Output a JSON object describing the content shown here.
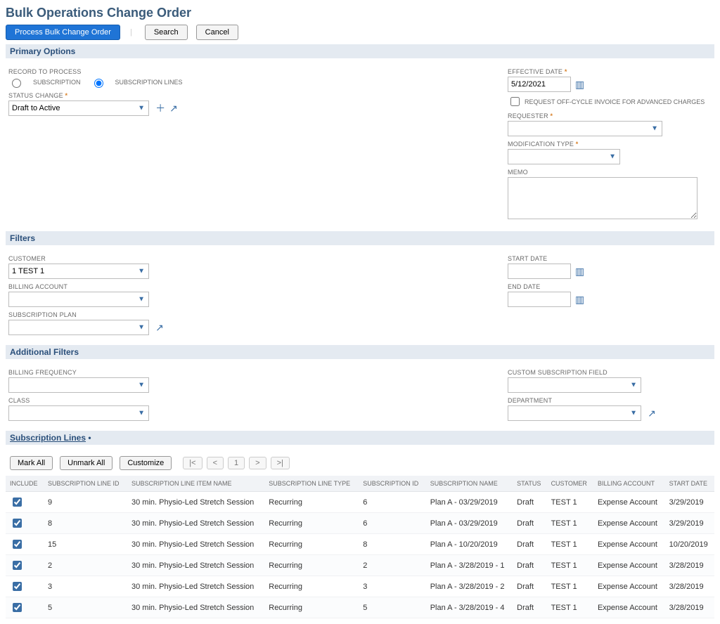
{
  "page": {
    "title": "Bulk Operations Change Order"
  },
  "toolbar": {
    "process": "Process Bulk Change Order",
    "search": "Search",
    "cancel": "Cancel"
  },
  "sections": {
    "primary": "Primary Options",
    "filters": "Filters",
    "additional": "Additional Filters",
    "sublines": "Subscription Lines"
  },
  "primary": {
    "record_to_process_label": "RECORD TO PROCESS",
    "radio_subscription": "SUBSCRIPTION",
    "radio_subscription_lines": "SUBSCRIPTION LINES",
    "status_change_label": "STATUS CHANGE",
    "status_change_value": "Draft to Active",
    "effective_date_label": "EFFECTIVE DATE",
    "effective_date_value": "5/12/2021",
    "offcycle_label": "REQUEST OFF-CYCLE INVOICE FOR ADVANCED CHARGES",
    "requester_label": "REQUESTER",
    "requester_value": "",
    "modification_type_label": "MODIFICATION TYPE",
    "modification_type_value": "",
    "memo_label": "MEMO",
    "memo_value": ""
  },
  "filters": {
    "customer_label": "CUSTOMER",
    "customer_value": "1 TEST 1",
    "billing_account_label": "BILLING ACCOUNT",
    "billing_account_value": "",
    "subscription_plan_label": "SUBSCRIPTION PLAN",
    "subscription_plan_value": "",
    "start_date_label": "START DATE",
    "start_date_value": "",
    "end_date_label": "END DATE",
    "end_date_value": ""
  },
  "additional": {
    "billing_frequency_label": "BILLING FREQUENCY",
    "billing_frequency_value": "",
    "class_label": "CLASS",
    "class_value": "",
    "custom_sub_field_label": "CUSTOM SUBSCRIPTION FIELD",
    "custom_sub_field_value": "",
    "department_label": "DEPARTMENT",
    "department_value": ""
  },
  "sublines": {
    "mark_all": "Mark All",
    "unmark_all": "Unmark All",
    "customize": "Customize",
    "pager": {
      "first": "|<",
      "prev": "<",
      "page": "1",
      "next": ">",
      "last": ">|"
    },
    "headers": {
      "include": "INCLUDE",
      "line_id": "SUBSCRIPTION LINE ID",
      "item_name": "SUBSCRIPTION LINE ITEM NAME",
      "line_type": "SUBSCRIPTION LINE TYPE",
      "sub_id": "SUBSCRIPTION ID",
      "sub_name": "SUBSCRIPTION NAME",
      "status": "STATUS",
      "customer": "CUSTOMER",
      "billing_account": "BILLING ACCOUNT",
      "start_date": "START DATE"
    },
    "rows": [
      {
        "include": true,
        "line_id": "9",
        "item_name": "30 min. Physio-Led Stretch Session",
        "line_type": "Recurring",
        "sub_id": "6",
        "sub_name": "Plan A - 03/29/2019",
        "status": "Draft",
        "customer": "TEST 1",
        "billing_account": "Expense Account",
        "start_date": "3/29/2019"
      },
      {
        "include": true,
        "line_id": "8",
        "item_name": "30 min. Physio-Led Stretch Session",
        "line_type": "Recurring",
        "sub_id": "6",
        "sub_name": "Plan A - 03/29/2019",
        "status": "Draft",
        "customer": "TEST 1",
        "billing_account": "Expense Account",
        "start_date": "3/29/2019"
      },
      {
        "include": true,
        "line_id": "15",
        "item_name": "30 min. Physio-Led Stretch Session",
        "line_type": "Recurring",
        "sub_id": "8",
        "sub_name": "Plan A - 10/20/2019",
        "status": "Draft",
        "customer": "TEST 1",
        "billing_account": "Expense Account",
        "start_date": "10/20/2019"
      },
      {
        "include": true,
        "line_id": "2",
        "item_name": "30 min. Physio-Led Stretch Session",
        "line_type": "Recurring",
        "sub_id": "2",
        "sub_name": "Plan A - 3/28/2019 - 1",
        "status": "Draft",
        "customer": "TEST 1",
        "billing_account": "Expense Account",
        "start_date": "3/28/2019"
      },
      {
        "include": true,
        "line_id": "3",
        "item_name": "30 min. Physio-Led Stretch Session",
        "line_type": "Recurring",
        "sub_id": "3",
        "sub_name": "Plan A - 3/28/2019 - 2",
        "status": "Draft",
        "customer": "TEST 1",
        "billing_account": "Expense Account",
        "start_date": "3/28/2019"
      },
      {
        "include": true,
        "line_id": "5",
        "item_name": "30 min. Physio-Led Stretch Session",
        "line_type": "Recurring",
        "sub_id": "5",
        "sub_name": "Plan A - 3/28/2019 - 4",
        "status": "Draft",
        "customer": "TEST 1",
        "billing_account": "Expense Account",
        "start_date": "3/28/2019"
      }
    ]
  }
}
